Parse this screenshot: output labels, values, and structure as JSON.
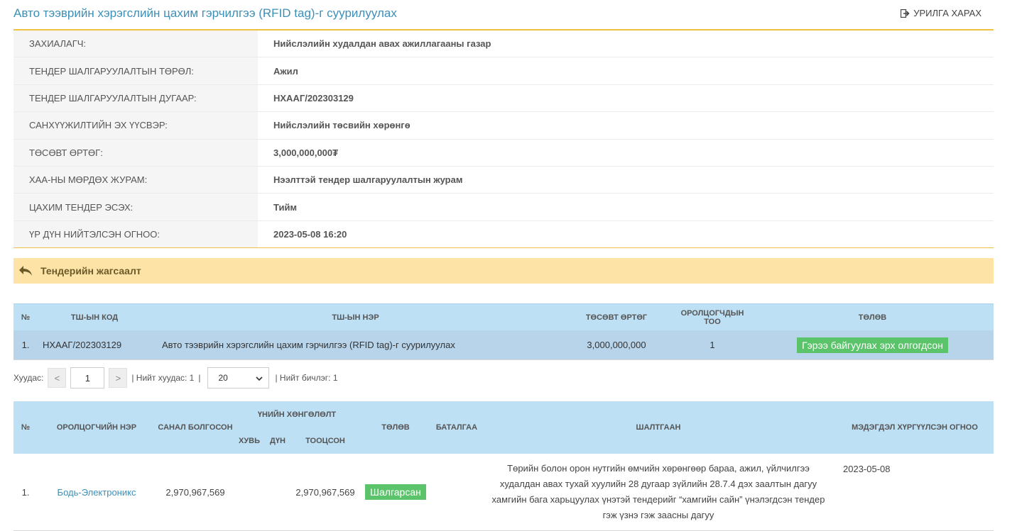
{
  "header": {
    "title": "Авто тээврийн хэрэгслийн цахим гэрчилгээ (RFID tag)-г суурилуулах",
    "back_label": "УРИЛГА ХАРАХ"
  },
  "info": [
    {
      "label": "ЗАХИАЛАГЧ:",
      "value": "Нийслэлийн худалдан авах ажиллагааны газар"
    },
    {
      "label": "ТЕНДЕР ШАЛГАРУУЛАЛТЫН ТӨРӨЛ:",
      "value": "Ажил"
    },
    {
      "label": "ТЕНДЕР ШАЛГАРУУЛАЛТЫН ДУГААР:",
      "value": "НХААГ/202303129"
    },
    {
      "label": "САНХҮҮЖИЛТИЙН ЭХ ҮҮСВЭР:",
      "value": "Нийслэлийн төсвийн хөрөнгө"
    },
    {
      "label": "ТӨСӨВТ ӨРТӨГ:",
      "value": "3,000,000,000₮"
    },
    {
      "label": "ХАА-НЫ МӨРДӨХ ЖУРАМ:",
      "value": "Нээлттэй тендер шалгаруулалтын журам"
    },
    {
      "label": "ЦАХИМ ТЕНДЕР ЭСЭХ:",
      "value": "Тийм"
    },
    {
      "label": "ҮР ДҮН НИЙТЭЛСЭН ОГНОО:",
      "value": "2023-05-08 16:20"
    }
  ],
  "section": {
    "title": "Тендерийн жагсаалт"
  },
  "tender_table": {
    "headers": {
      "no": "№",
      "code": "ТШ-ЫН КОД",
      "name": "ТШ-ЫН НЭР",
      "budget": "ТӨСӨВТ ӨРТӨГ",
      "participants": "ОРОЛЦОГЧДЫН ТОО",
      "status": "ТӨЛӨВ"
    },
    "rows": [
      {
        "no": "1.",
        "code": "НХААГ/202303129",
        "name": "Авто тээврийн хэрэгслийн цахим гэрчилгээ (RFID tag)-г суурилуулах",
        "budget": "3,000,000,000",
        "participants": "1",
        "status": "Гэрээ байгуулах эрх олгогдсон"
      }
    ]
  },
  "pager": {
    "pages_label": "Хуудас:",
    "prev": "<",
    "next": ">",
    "page_value": "1",
    "total_pages": "| Нийт хуудас: 1",
    "sep": "|",
    "per_page": "20",
    "total_records": "|  Нийт бичлэг: 1"
  },
  "bid_table": {
    "headers": {
      "no": "№",
      "name": "ОРОЛЦОГЧИЙН НЭР",
      "offered": "САНАЛ БОЛГОСОН",
      "discount": "ҮНИЙН ХӨНГӨЛӨЛТ",
      "rate": "ХУВЬ",
      "amount": "ДҮН",
      "calc": "ТООЦСОН",
      "status": "ТӨЛӨВ",
      "guarantee": "БАТАЛГАА",
      "reason": "ШАЛТГААН",
      "notified": "МЭДЭГДЭЛ ХҮРГҮҮЛСЭН ОГНОО"
    },
    "rows": [
      {
        "no": "1.",
        "name": "Бодь-Электроникс",
        "offered": "2,970,967,569",
        "rate": "",
        "amount": "",
        "calc": "2,970,967,569",
        "status": "Шалгарсан",
        "guarantee": "",
        "reason": "Төрийн болон орон нутгийн өмчийн хөрөнгөөр бараа, ажил, үйлчилгээ худалдан авах тухай хуулийн 28 дугаар зүйлийн 28.7.4 дэх заалтын дагуу хамгийн бага харьцуулах үнэтэй тендерийг “хамгийн сайн” үнэлэгдсэн тендер гэж үзнэ гэж заасны дагуу",
        "notified": "2023-05-08"
      }
    ]
  },
  "colors": {
    "accent": "#3d8fb8",
    "header_bg": "#bde0f5",
    "section_bg": "#fde3a5",
    "badge_green": "#5bc46a",
    "gold_line": "#f0c040"
  },
  "icons": {
    "back": "sign-out-icon",
    "section": "reply-arrow-icon"
  }
}
